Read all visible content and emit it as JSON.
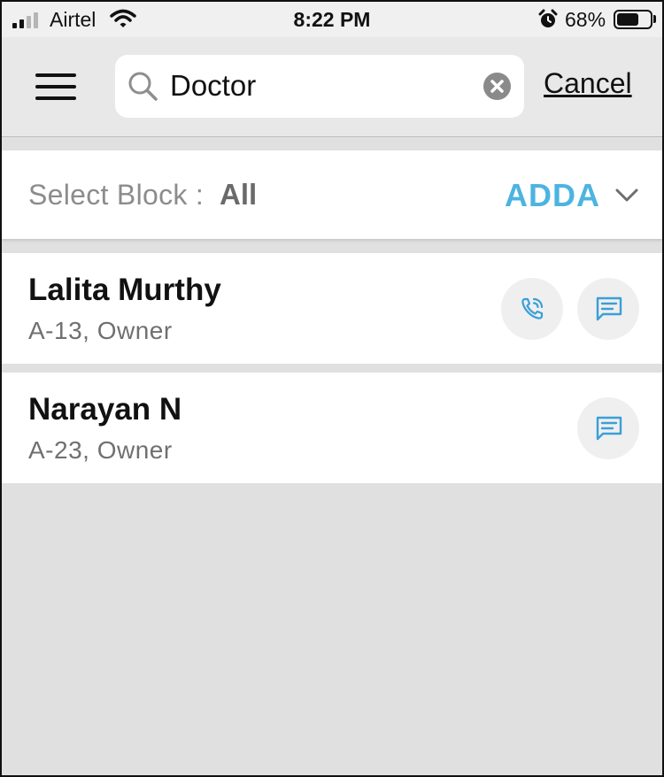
{
  "status_bar": {
    "carrier": "Airtel",
    "time": "8:22 PM",
    "battery_percent": "68%",
    "battery_level": 0.68,
    "signal_bars": 2
  },
  "search": {
    "query": "Doctor",
    "cancel_label": "Cancel"
  },
  "block_filter": {
    "label": "Select Block :",
    "value": "All",
    "brand": "ADDA"
  },
  "contacts": [
    {
      "name": "Lalita Murthy",
      "detail": "A-13, Owner",
      "can_call": true,
      "can_message": true
    },
    {
      "name": "Narayan N",
      "detail": "A-23, Owner",
      "can_call": false,
      "can_message": true
    }
  ],
  "colors": {
    "accent": "#4cb4e0",
    "background": "#e0e0e0",
    "header": "#e8e8e8"
  },
  "icons": [
    "signal-icon",
    "wifi-icon",
    "alarm-icon",
    "battery-icon",
    "menu-icon",
    "search-icon",
    "clear-icon",
    "chevron-down-icon",
    "phone-icon",
    "chat-icon"
  ]
}
